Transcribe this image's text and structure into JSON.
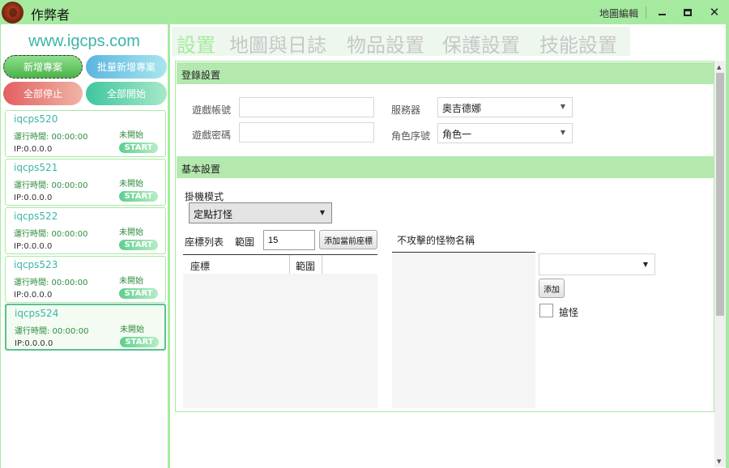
{
  "titlebar": {
    "title": "作弊者",
    "map_edit": "地圖編輯",
    "icons": {
      "app": "wax-seal-icon",
      "minimize": "minimize-icon",
      "maximize": "maximize-icon",
      "close": "close-icon"
    },
    "close_glyph": "✕"
  },
  "sidebar": {
    "site_url": "www.igcps.com",
    "buttons": {
      "new_profile": "新增專案",
      "batch_new": "批量新增專案",
      "stop_all": "全部停止",
      "start_all": "全部開始"
    },
    "profiles": [
      {
        "name": "iqcps520",
        "runtime": "運行時間: 00:00:00",
        "status": "未開始",
        "ip": "IP:0.0.0.0",
        "action": "START"
      },
      {
        "name": "iqcps521",
        "runtime": "運行時間: 00:00:00",
        "status": "未開始",
        "ip": "IP:0.0.0.0",
        "action": "START"
      },
      {
        "name": "iqcps522",
        "runtime": "運行時間: 00:00:00",
        "status": "未開始",
        "ip": "IP:0.0.0.0",
        "action": "START"
      },
      {
        "name": "iqcps523",
        "runtime": "運行時間: 00:00:00",
        "status": "未開始",
        "ip": "IP:0.0.0.0",
        "action": "START"
      },
      {
        "name": "iqcps524",
        "runtime": "運行時間: 00:00:00",
        "status": "未開始",
        "ip": "IP:0.0.0.0",
        "action": "START"
      }
    ]
  },
  "tabs": [
    "設置",
    "地圖與日誌",
    "物品設置",
    "保護設置",
    "技能設置"
  ],
  "login_settings": {
    "header": "登錄設置",
    "account_label": "遊戲帳號",
    "account_value": "",
    "password_label": "遊戲密碼",
    "password_value": "",
    "server_label": "服務器",
    "server_value": "奧吉德娜",
    "role_label": "角色序號",
    "role_value": "角色一"
  },
  "basic_settings": {
    "header": "基本設置",
    "idle_mode_label": "掛機模式",
    "idle_mode_value": "定點打怪",
    "coord_list_label": "座標列表",
    "range_label": "範圍",
    "range_value": "15",
    "add_coord_button": "添加當前座標",
    "coord_columns": [
      "座標",
      "範圍"
    ],
    "no_attack_label": "不攻擊的怪物名稱",
    "monster_combo_value": "",
    "add_button": "添加",
    "grab_monster_label": "搶怪",
    "grab_monster_checked": false
  },
  "colors": {
    "accent": "#a6eaa0",
    "section_header": "#b5e8ae",
    "link_teal": "#3ab6a6"
  }
}
